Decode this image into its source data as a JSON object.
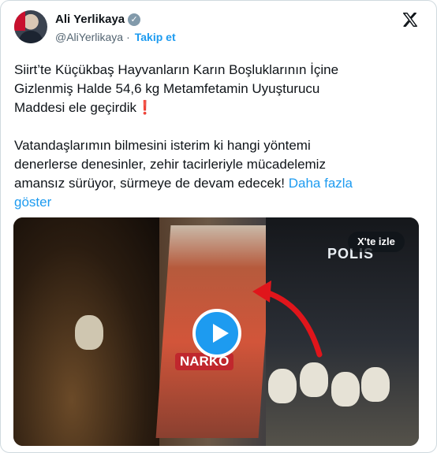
{
  "header": {
    "name": "Ali Yerlikaya",
    "handle": "@AliYerlikaya",
    "separator": "·",
    "follow_label": "Takip et",
    "verified_icon": "verified-badge-icon"
  },
  "tweet": {
    "text": "Siirt’te Küçükbaş Hayvanların Karın Boşluklarının İçine\nGizlenmiş Halde 54,6 kg Metamfetamin Uyuşturucu\nMaddesi ele geçirdik❗\n\nVatandaşlarımın bilmesini isterim ki hangi yöntemi\ndenerlerse denesinler, zehir tacirleriyle mücadelemiz\namansız sürüyor, sürmeye de devam edecek! ",
    "show_more": "Daha fazla\ngöster"
  },
  "media": {
    "watch_label": "X'te izle",
    "overlay_polis": "POLIS",
    "overlay_narko": "NARKO"
  },
  "colors": {
    "accent": "#1d9bf0",
    "text": "#0f1419",
    "secondary": "#536471",
    "border": "#cfd9de"
  }
}
